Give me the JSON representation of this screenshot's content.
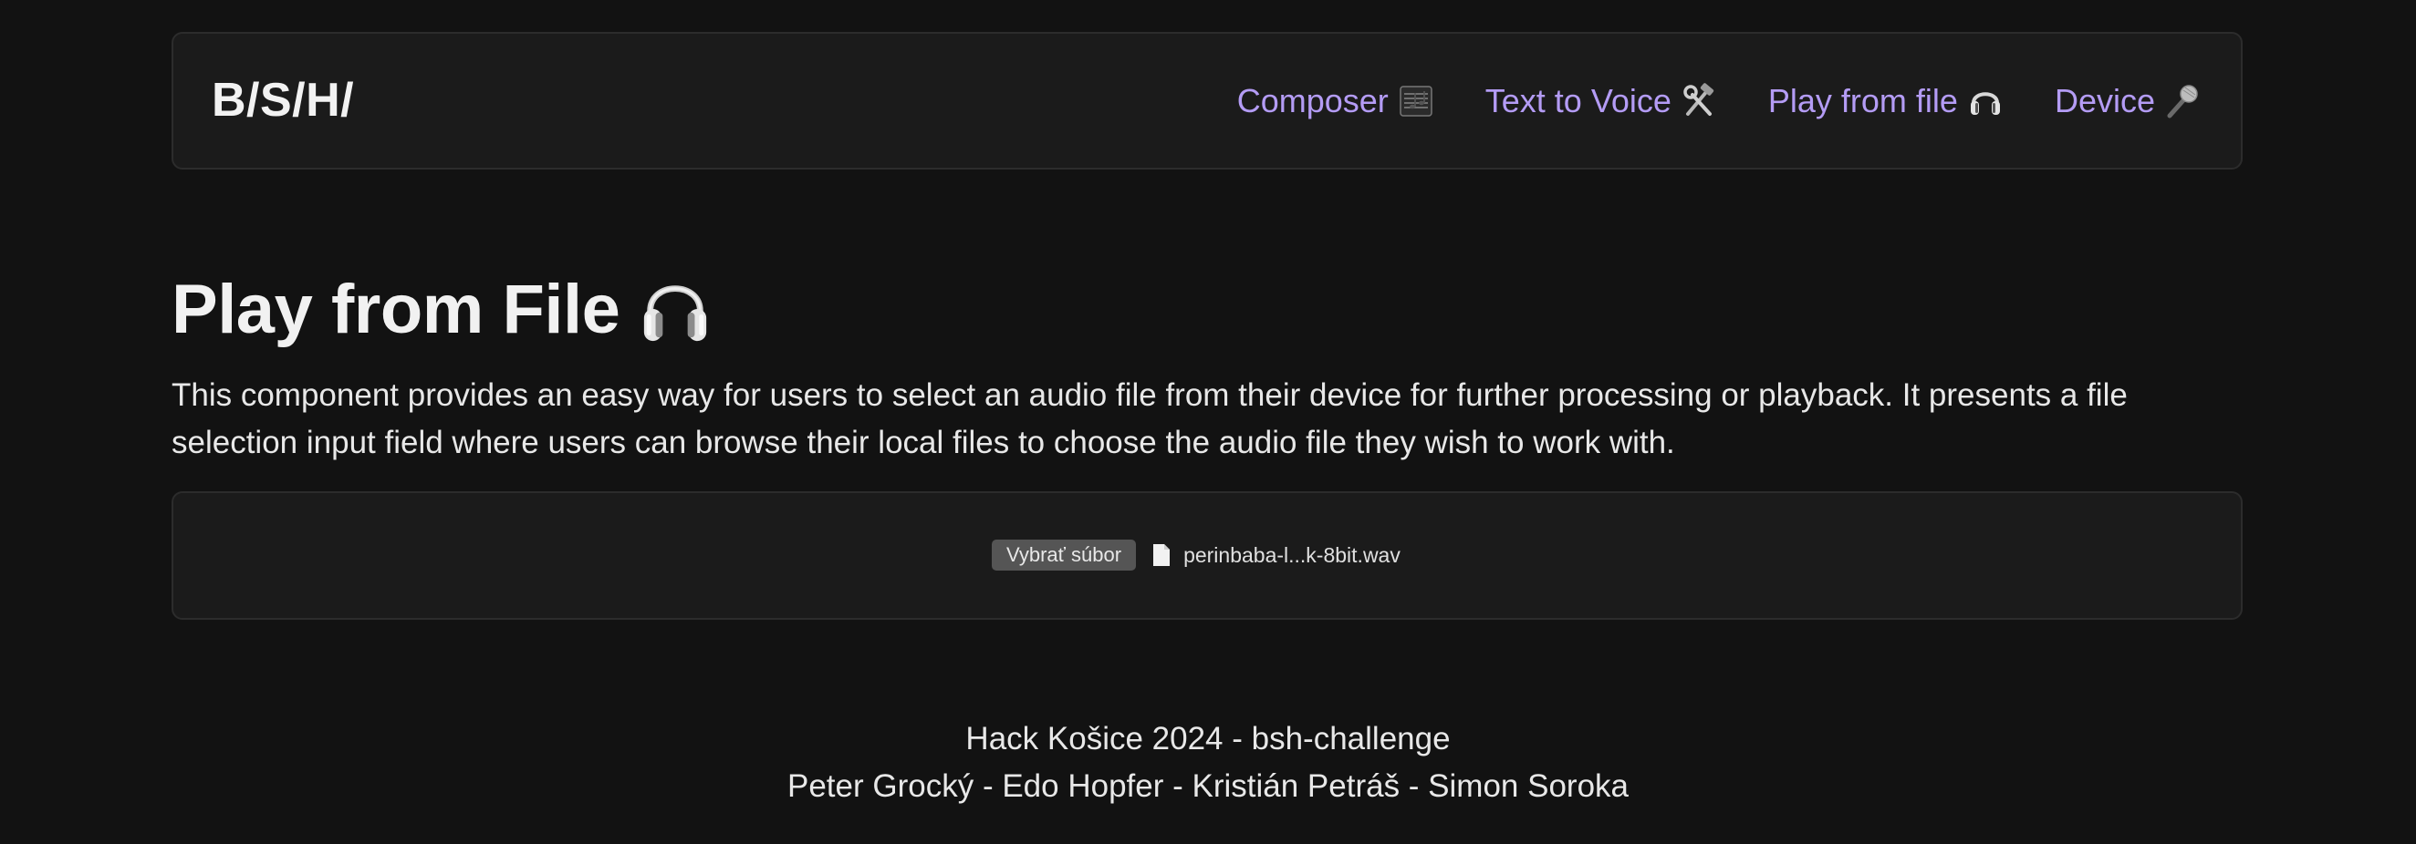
{
  "header": {
    "brand": "B/S/H/",
    "nav": [
      {
        "label": "Composer",
        "icon": "music-sheet-icon"
      },
      {
        "label": "Text to Voice",
        "icon": "hammer-wrench-icon"
      },
      {
        "label": "Play from file",
        "icon": "headphones-icon"
      },
      {
        "label": "Device",
        "icon": "microphone-icon"
      }
    ]
  },
  "main": {
    "title": "Play from File",
    "title_icon": "headphones-icon",
    "description": "This component provides an easy way for users to select an audio file from their device for further processing or playback. It presents a file selection input field where users can browse their local files to choose the audio file they wish to work with.",
    "file_input": {
      "button_label": "Vybrať súbor",
      "file_icon": "document-icon",
      "file_name": "perinbaba-l...k-8bit.wav"
    }
  },
  "footer": {
    "line1": "Hack Košice 2024 - bsh-challenge",
    "line2": "Peter Grocký - Edo Hopfer - Kristián Petráš - Simon Soroka"
  },
  "colors": {
    "background": "#121212",
    "card": "#1b1b1b",
    "accent": "#b49cf5",
    "text": "#ececec"
  }
}
